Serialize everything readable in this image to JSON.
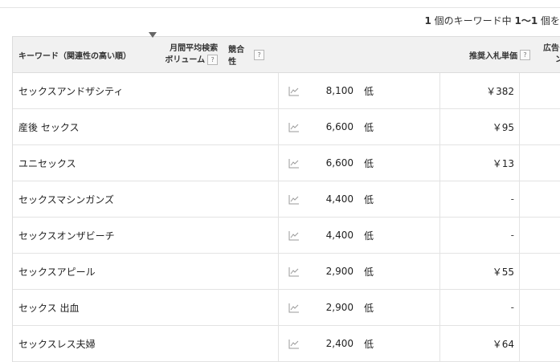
{
  "summary": {
    "prefix": "1",
    "middle": " 個のキーワード中 ",
    "range": "1〜1",
    "suffix": " 個を"
  },
  "header": {
    "keyword": "キーワード（関連性の高い順）",
    "volume_line1": "月間平均検索",
    "volume_line2": "ボリューム",
    "competition": "競合性",
    "bid": "推奨入札単価",
    "ad_line1": "広告イン",
    "ad_line2": "ン",
    "help": "?"
  },
  "rows": [
    {
      "keyword": "セックスアンドザシティ",
      "volume": "8,100",
      "competition": "低",
      "bid": "￥382"
    },
    {
      "keyword": "産後 セックス",
      "volume": "6,600",
      "competition": "低",
      "bid": "￥95"
    },
    {
      "keyword": "ユニセックス",
      "volume": "6,600",
      "competition": "低",
      "bid": "￥13"
    },
    {
      "keyword": "セックスマシンガンズ",
      "volume": "4,400",
      "competition": "低",
      "bid": "-"
    },
    {
      "keyword": "セックスオンザビーチ",
      "volume": "4,400",
      "competition": "低",
      "bid": "-"
    },
    {
      "keyword": "セックスアピール",
      "volume": "2,900",
      "competition": "低",
      "bid": "￥55"
    },
    {
      "keyword": "セックス 出血",
      "volume": "2,900",
      "competition": "低",
      "bid": "-"
    },
    {
      "keyword": "セックスレス夫婦",
      "volume": "2,400",
      "competition": "低",
      "bid": "￥64"
    }
  ],
  "icons": {
    "sort": "sort-down-icon",
    "trend": "trend-chart-icon",
    "help": "help-icon"
  }
}
